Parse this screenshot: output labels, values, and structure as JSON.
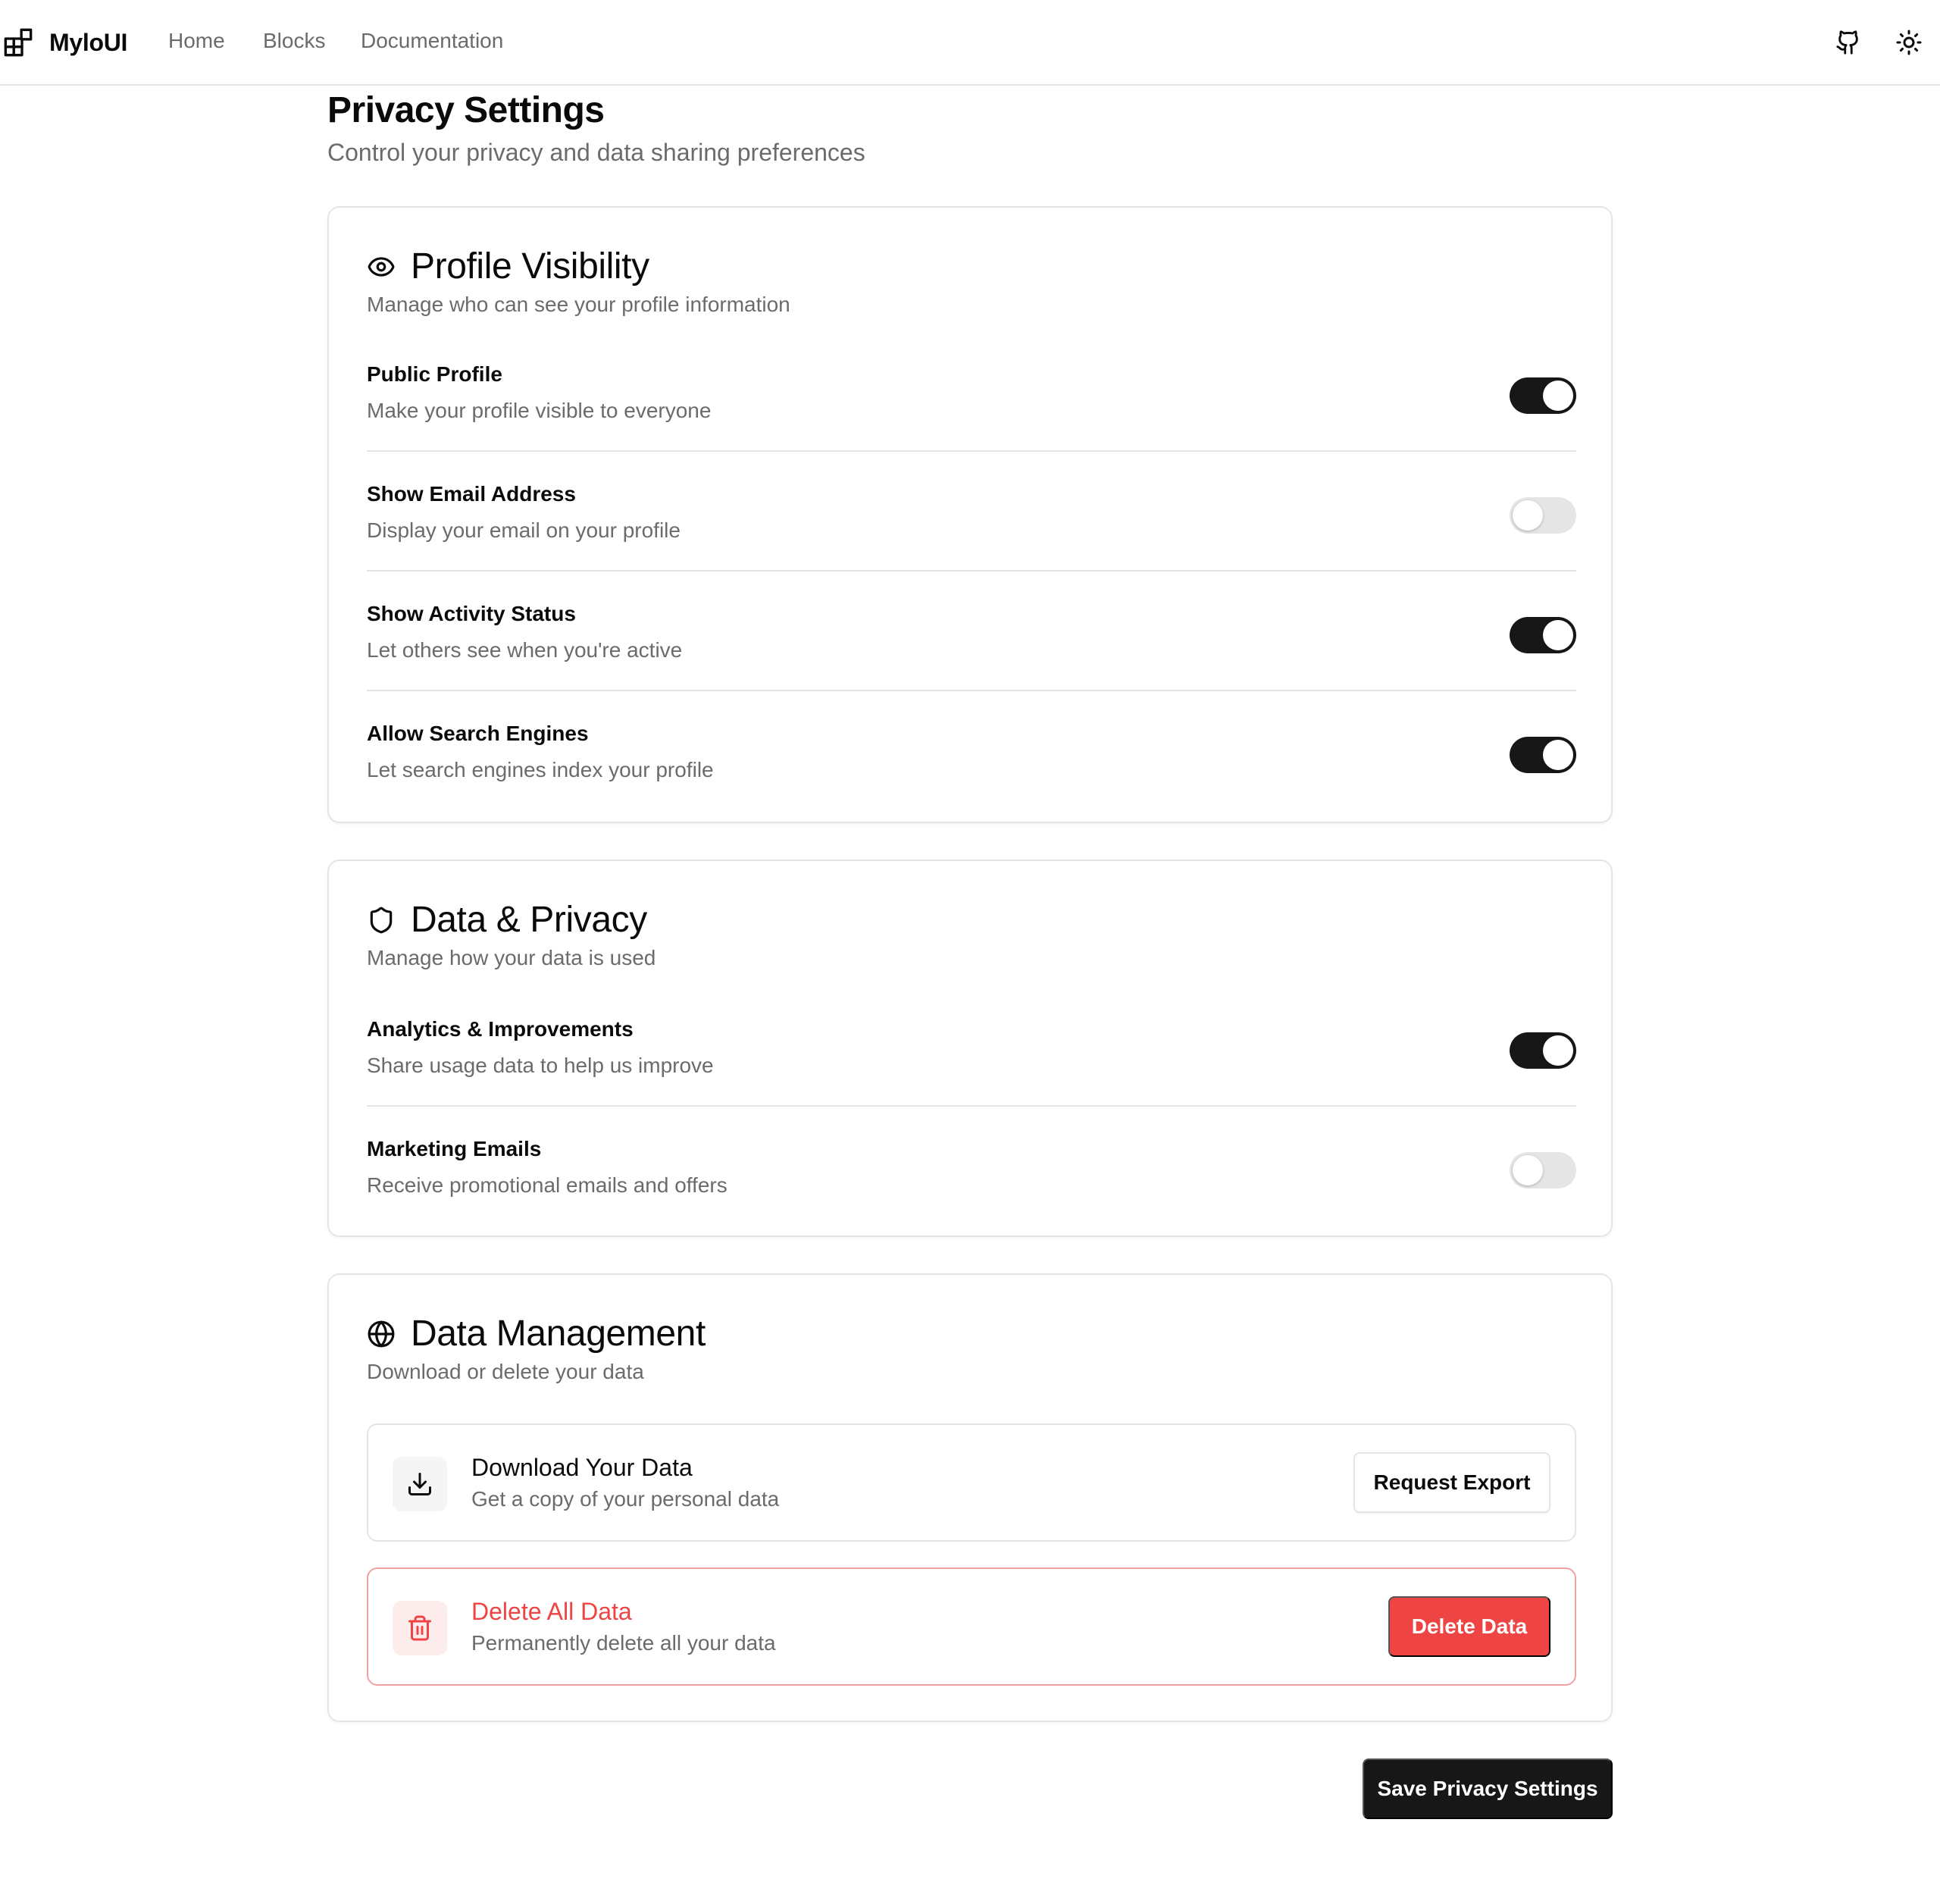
{
  "nav": {
    "brand": "MyloUI",
    "links": [
      "Home",
      "Blocks",
      "Documentation"
    ],
    "icons": [
      "github-icon",
      "sun-icon"
    ]
  },
  "page": {
    "title": "Privacy Settings",
    "subtitle": "Control your privacy and data sharing preferences"
  },
  "profile_visibility": {
    "icon": "eye-icon",
    "title": "Profile Visibility",
    "description": "Manage who can see your profile information",
    "settings": [
      {
        "label": "Public Profile",
        "description": "Make your profile visible to everyone",
        "enabled": true
      },
      {
        "label": "Show Email Address",
        "description": "Display your email on your profile",
        "enabled": false
      },
      {
        "label": "Show Activity Status",
        "description": "Let others see when you're active",
        "enabled": true
      },
      {
        "label": "Allow Search Engines",
        "description": "Let search engines index your profile",
        "enabled": true
      }
    ]
  },
  "data_privacy": {
    "icon": "shield-icon",
    "title": "Data & Privacy",
    "description": "Manage how your data is used",
    "settings": [
      {
        "label": "Analytics & Improvements",
        "description": "Share usage data to help us improve",
        "enabled": true
      },
      {
        "label": "Marketing Emails",
        "description": "Receive promotional emails and offers",
        "enabled": false
      }
    ]
  },
  "data_management": {
    "icon": "globe-icon",
    "title": "Data Management",
    "description": "Download or delete your data",
    "download": {
      "icon": "download-icon",
      "title": "Download Your Data",
      "description": "Get a copy of your personal data",
      "button": "Request Export"
    },
    "delete": {
      "icon": "trash-icon",
      "title": "Delete All Data",
      "description": "Permanently delete all your data",
      "button": "Delete Data"
    }
  },
  "save_button": "Save Privacy Settings",
  "colors": {
    "primary": "#171717",
    "destructive": "#ef4444",
    "muted_text": "#6b6b6b",
    "border": "#e5e5e5"
  }
}
